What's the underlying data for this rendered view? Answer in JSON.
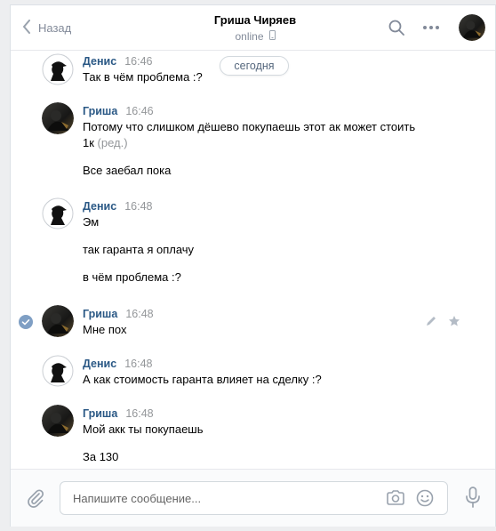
{
  "header": {
    "back_label": "Назад",
    "contact_name": "Гриша Чиряев",
    "status": "online"
  },
  "date_divider": "сегодня",
  "messages": [
    {
      "author": "Денис",
      "time": "16:46",
      "avatar": "silhouette",
      "lines": [
        "Так в чём проблема :?"
      ]
    },
    {
      "author": "Гриша",
      "time": "16:46",
      "avatar": "photo",
      "lines": [
        "Потому что слишком дёшево покупаешь этот ак может стоить",
        "1к",
        "Все заебал пока"
      ],
      "edited": "(ред.)"
    },
    {
      "author": "Денис",
      "time": "16:48",
      "avatar": "silhouette",
      "lines": [
        "Эм",
        "так гаранта я оплачу",
        "в чём проблема :?"
      ]
    },
    {
      "author": "Гриша",
      "time": "16:48",
      "avatar": "photo",
      "lines": [
        "Мне пох"
      ]
    },
    {
      "author": "Денис",
      "time": "16:48",
      "avatar": "silhouette",
      "lines": [
        "А как стоимость гаранта влияет на сделку :?"
      ]
    },
    {
      "author": "Гриша",
      "time": "16:48",
      "avatar": "photo",
      "lines": [
        "Мой акк ты покупаешь",
        "За 130"
      ]
    }
  ],
  "composer": {
    "placeholder": "Напишите сообщение..."
  },
  "icons": {
    "back": "chevron-left-icon",
    "search": "search-icon",
    "more": "more-dots-icon",
    "mobile": "mobile-phone-icon",
    "attach": "paperclip-icon",
    "camera": "camera-icon",
    "emoji": "smile-icon",
    "mic": "microphone-icon",
    "edit": "pencil-icon",
    "star": "star-icon",
    "selected": "check-circle-icon"
  },
  "colors": {
    "accent": "#2a5885",
    "muted": "#828a99",
    "selected_check": "#7f9fc4"
  }
}
